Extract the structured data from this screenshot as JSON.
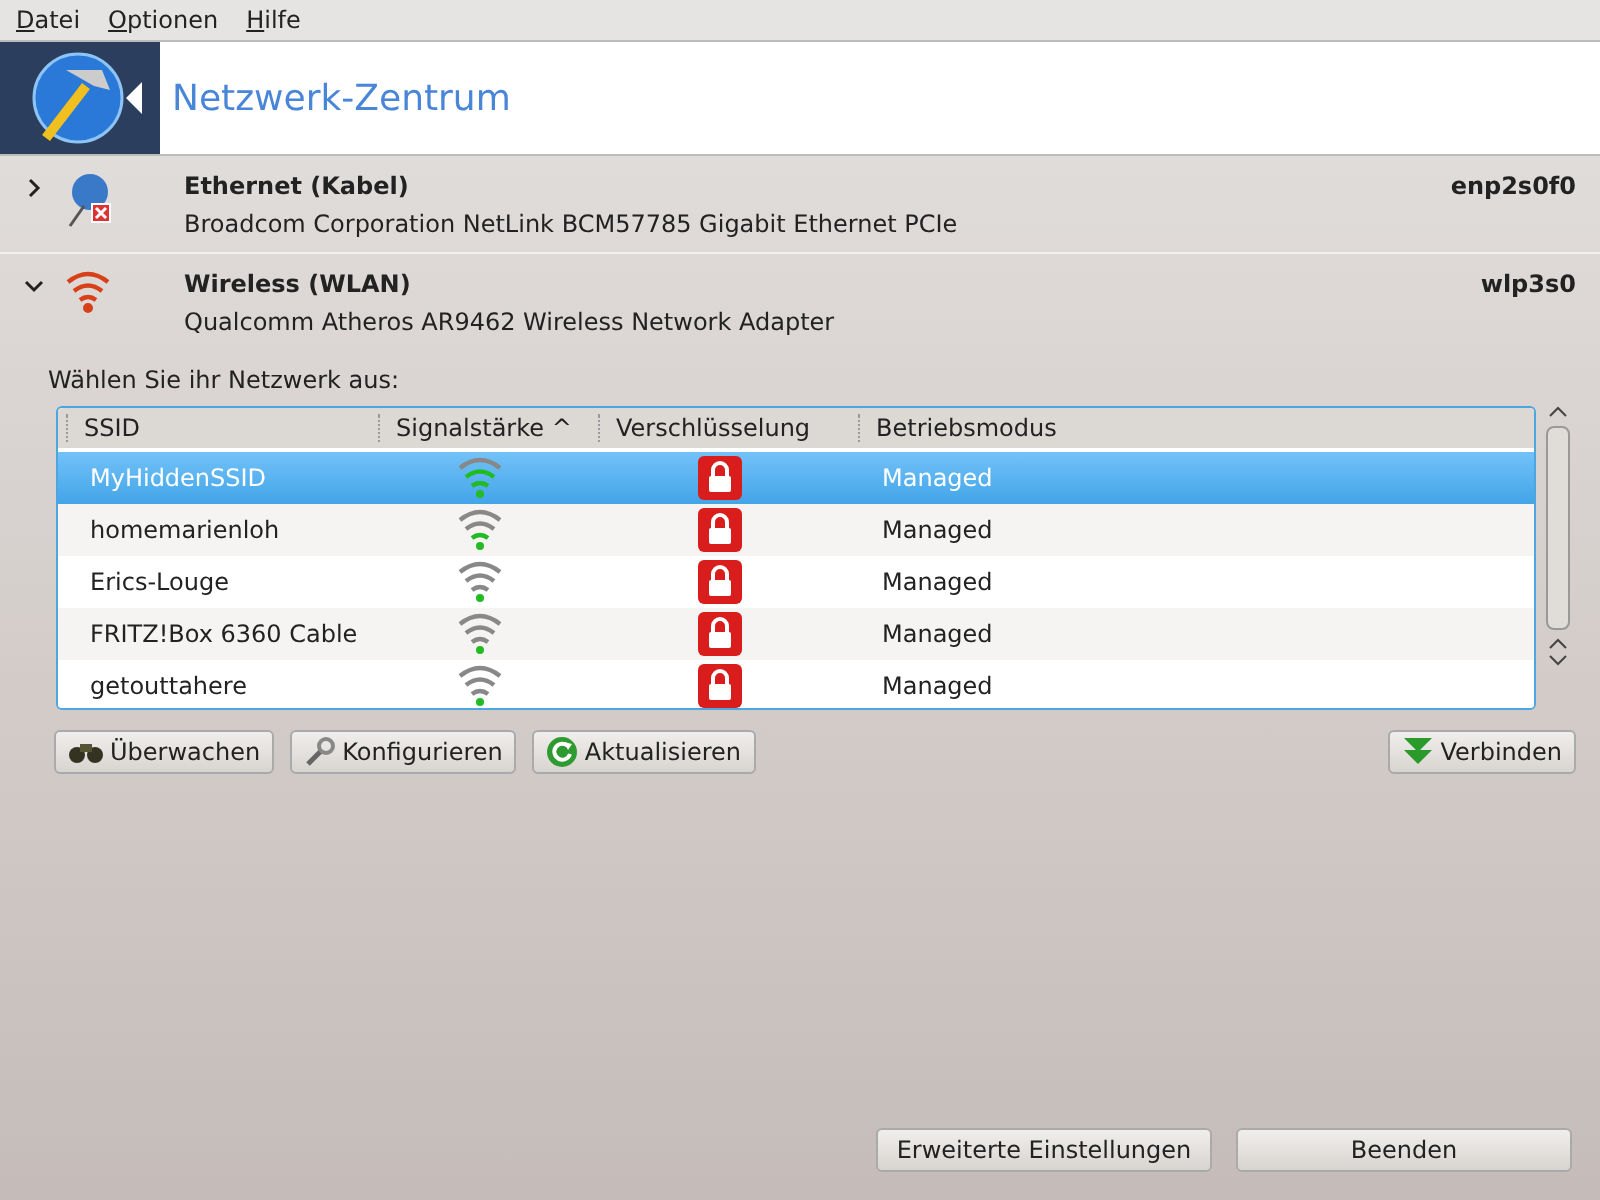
{
  "menu": [
    "Datei",
    "Optionen",
    "Hilfe"
  ],
  "header": {
    "title": "Netzwerk-Zentrum"
  },
  "devices": [
    {
      "kind": "ethernet",
      "expanded": false,
      "name": "Ethernet (Kabel)",
      "description": "Broadcom Corporation NetLink BCM57785 Gigabit Ethernet PCIe",
      "interface": "enp2s0f0"
    },
    {
      "kind": "wireless",
      "expanded": true,
      "name": "Wireless (WLAN)",
      "description": "Qualcomm Atheros AR9462 Wireless Network Adapter",
      "interface": "wlp3s0"
    }
  ],
  "prompt": "Wählen Sie ihr Netzwerk aus:",
  "table": {
    "columns": [
      "SSID",
      "Signalstärke ^",
      "Verschlüsselung",
      "Betriebsmodus"
    ],
    "rows": [
      {
        "ssid": "MyHiddenSSID",
        "kind": "strong",
        "encrypted": true,
        "mode": "Managed",
        "selected": true
      },
      {
        "ssid": "homemarienloh",
        "kind": "medium",
        "encrypted": true,
        "mode": "Managed",
        "selected": false
      },
      {
        "ssid": "Erics-Louge",
        "kind": "weak",
        "encrypted": true,
        "mode": "Managed",
        "selected": false
      },
      {
        "ssid": "FRITZ!Box 6360 Cable",
        "kind": "weak",
        "encrypted": true,
        "mode": "Managed",
        "selected": false
      },
      {
        "ssid": "getouttahere",
        "kind": "weak",
        "encrypted": true,
        "mode": "Managed",
        "selected": false
      }
    ]
  },
  "actions": [
    {
      "kind": "monitor",
      "label": "Überwachen"
    },
    {
      "kind": "configure",
      "label": "Konfigurieren"
    },
    {
      "kind": "refresh",
      "label": "Aktualisieren"
    },
    {
      "kind": "connect",
      "label": "Verbinden"
    }
  ],
  "footer": [
    "Erweiterte Einstellungen",
    "Beenden"
  ]
}
